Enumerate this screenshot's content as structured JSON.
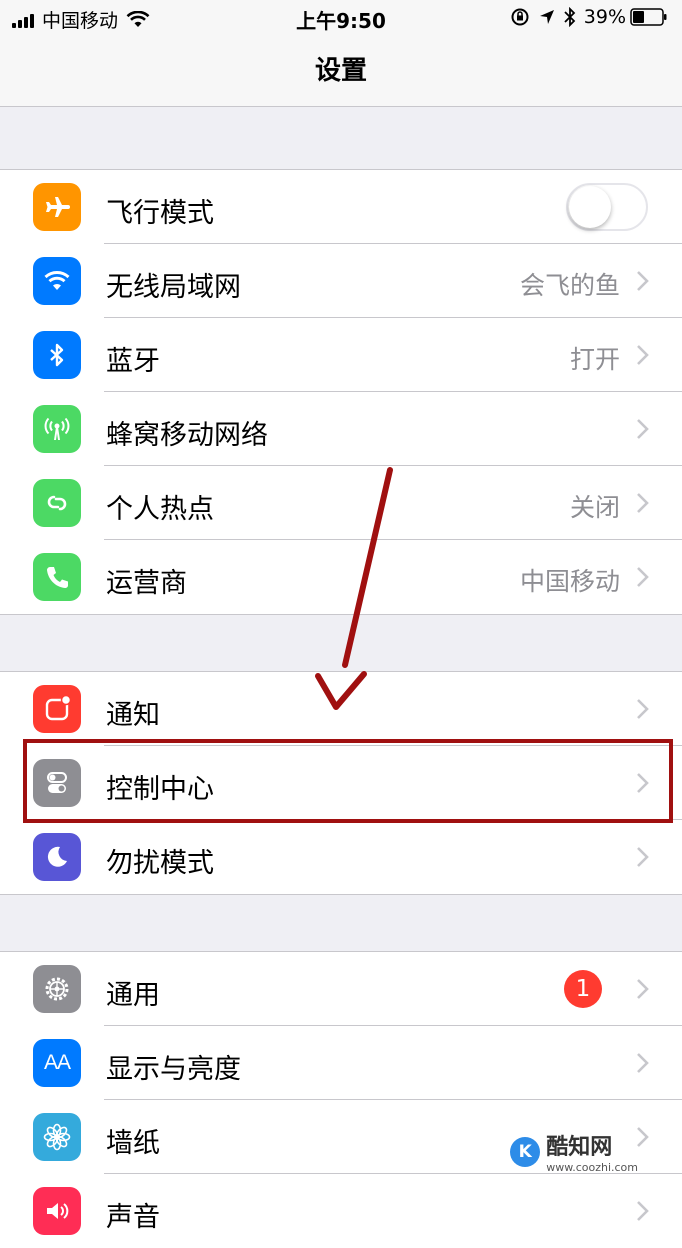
{
  "status_bar": {
    "carrier": "中国移动",
    "time": "上午9:50",
    "battery": "39%"
  },
  "nav": {
    "title": "设置"
  },
  "groups": [
    {
      "items": [
        {
          "label": "飞行模式",
          "icon": "airplane-icon",
          "color": "#ff9500",
          "toggle": false
        },
        {
          "label": "无线局域网",
          "icon": "wifi-icon",
          "color": "#007aff",
          "value": "会飞的鱼"
        },
        {
          "label": "蓝牙",
          "icon": "bluetooth-icon",
          "color": "#007aff",
          "value": "打开"
        },
        {
          "label": "蜂窝移动网络",
          "icon": "cellular-icon",
          "color": "#4cd964",
          "value": ""
        },
        {
          "label": "个人热点",
          "icon": "hotspot-icon",
          "color": "#4cd964",
          "value": "关闭"
        },
        {
          "label": "运营商",
          "icon": "phone-icon",
          "color": "#4cd964",
          "value": "中国移动"
        }
      ]
    },
    {
      "items": [
        {
          "label": "通知",
          "icon": "notifications-icon",
          "color": "#ff3b30"
        },
        {
          "label": "控制中心",
          "icon": "control-center-icon",
          "color": "#8e8e93"
        },
        {
          "label": "勿扰模式",
          "icon": "moon-icon",
          "color": "#5856d6"
        }
      ]
    },
    {
      "items": [
        {
          "label": "通用",
          "icon": "gear-icon",
          "color": "#8e8e93",
          "badge": "1"
        },
        {
          "label": "显示与亮度",
          "icon": "display-icon",
          "color": "#007aff",
          "icon_text": "AA"
        },
        {
          "label": "墙纸",
          "icon": "wallpaper-icon",
          "color": "#34aadc"
        },
        {
          "label": "声音",
          "icon": "sound-icon",
          "color": "#ff2d55"
        }
      ]
    }
  ],
  "watermark": {
    "logo_text": "K",
    "name": "酷知网",
    "url": "www.coozhi.com"
  }
}
